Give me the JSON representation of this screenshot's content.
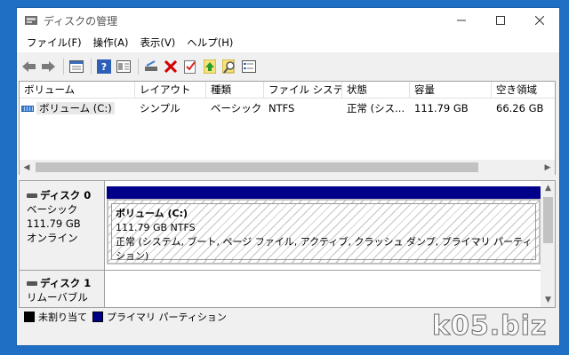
{
  "window": {
    "title": "ディスクの管理"
  },
  "menu": [
    "ファイル(F)",
    "操作(A)",
    "表示(V)",
    "ヘルプ(H)"
  ],
  "toolbar_icons": [
    "back-arrow-icon",
    "forward-arrow-icon",
    "properties-icon",
    "help-icon",
    "view-icon",
    "connect-icon",
    "delete-icon",
    "check-icon",
    "refresh-icon",
    "search-icon",
    "list-icon"
  ],
  "volumes": {
    "headers": [
      "ボリューム",
      "レイアウト",
      "種類",
      "ファイル システム",
      "状態",
      "容量",
      "空き領域"
    ],
    "rows": [
      {
        "name": "ボリューム (C:)",
        "layout": "シンプル",
        "type": "ベーシック",
        "fs": "NTFS",
        "status": "正常 (シス...",
        "capacity": "111.79 GB",
        "free": "66.26 GB"
      }
    ]
  },
  "disks": [
    {
      "name": "ディスク 0",
      "type": "ベーシック",
      "size": "111.79 GB",
      "state": "オンライン",
      "partition": {
        "name": "ボリューム (C:)",
        "size_fs": "111.79 GB NTFS",
        "status": "正常 (システム, ブート, ページ ファイル, アクティブ, クラッシュ ダンプ, プライマリ パーティション)"
      }
    },
    {
      "name": "ディスク 1",
      "type": "リムーバブル (F:)"
    }
  ],
  "legend": [
    {
      "label": "未割り当て",
      "color": "#000000"
    },
    {
      "label": "プライマリ パーティション",
      "color": "#00008b"
    }
  ],
  "watermark": "k05.biz"
}
